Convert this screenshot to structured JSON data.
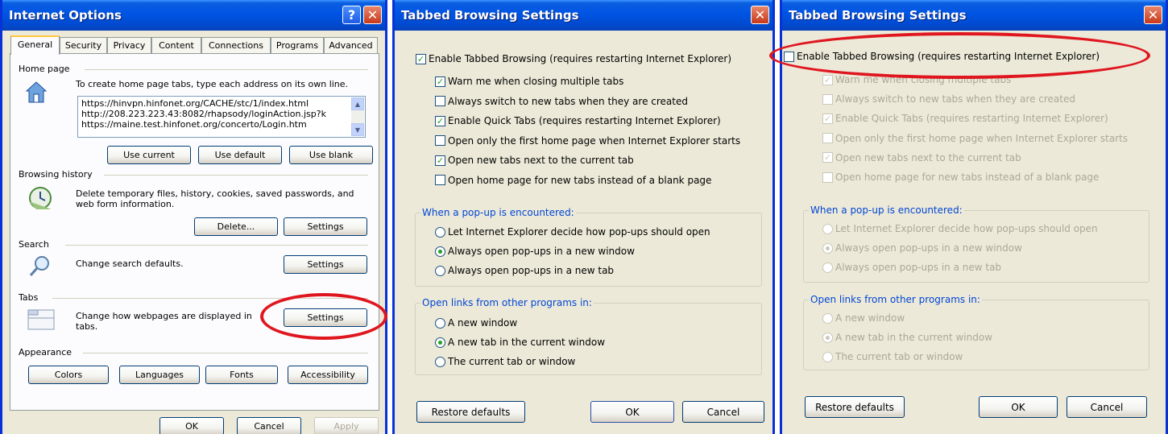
{
  "internet_options": {
    "title": "Internet Options",
    "tabs": [
      "General",
      "Security",
      "Privacy",
      "Content",
      "Connections",
      "Programs",
      "Advanced"
    ],
    "active_tab": "General",
    "home_page": {
      "heading": "Home page",
      "description": "To create home page tabs, type each address on its own line.",
      "urls": [
        "https://hinvpn.hinfonet.org/CACHE/stc/1/index.html",
        "http://208.223.223.43:8082/rhapsody/loginAction.jsp?k",
        "https://maine.test.hinfonet.org/concerto/Login.htm"
      ],
      "buttons": [
        "Use current",
        "Use default",
        "Use blank"
      ]
    },
    "browsing_history": {
      "heading": "Browsing history",
      "description": "Delete temporary files, history, cookies, saved passwords, and web form information.",
      "delete_label": "Delete...",
      "settings_label": "Settings"
    },
    "search": {
      "heading": "Search",
      "description": "Change search defaults.",
      "settings_label": "Settings"
    },
    "tabs_section": {
      "heading": "Tabs",
      "description": "Change how webpages are displayed in tabs.",
      "settings_label": "Settings"
    },
    "appearance": {
      "heading": "Appearance",
      "buttons": [
        "Colors",
        "Languages",
        "Fonts",
        "Accessibility"
      ]
    },
    "footer": {
      "ok": "OK",
      "cancel": "Cancel",
      "apply": "Apply"
    }
  },
  "tabbed_settings_enabled": {
    "title": "Tabbed Browsing Settings",
    "enable_label": "Enable Tabbed Browsing (requires restarting Internet Explorer)",
    "enable_checked": true,
    "options": [
      {
        "label": "Warn me when closing multiple tabs",
        "checked": true
      },
      {
        "label": "Always switch to new tabs when they are created",
        "checked": false
      },
      {
        "label": "Enable Quick Tabs (requires restarting Internet Explorer)",
        "checked": true
      },
      {
        "label": "Open only the first home page when Internet Explorer starts",
        "checked": false
      },
      {
        "label": "Open new tabs next to the current tab",
        "checked": true
      },
      {
        "label": "Open home page for new tabs instead of a blank page",
        "checked": false
      }
    ],
    "popup_group": {
      "title": "When a pop-up is encountered:",
      "options": [
        {
          "label": "Let Internet Explorer decide how pop-ups should open",
          "selected": false
        },
        {
          "label": "Always open pop-ups in a new window",
          "selected": true
        },
        {
          "label": "Always open pop-ups in a new tab",
          "selected": false
        }
      ]
    },
    "links_group": {
      "title": "Open links from other programs in:",
      "options": [
        {
          "label": "A new window",
          "selected": false
        },
        {
          "label": "A new tab in the current window",
          "selected": true
        },
        {
          "label": "The current tab or window",
          "selected": false
        }
      ]
    },
    "footer": {
      "restore": "Restore defaults",
      "ok": "OK",
      "cancel": "Cancel"
    }
  },
  "tabbed_settings_disabled": {
    "title": "Tabbed Browsing Settings",
    "enable_label": "Enable Tabbed Browsing (requires restarting Internet Explorer)",
    "enable_checked": false,
    "options": [
      {
        "label": "Warn me when closing multiple tabs",
        "checked": true
      },
      {
        "label": "Always switch to new tabs when they are created",
        "checked": false
      },
      {
        "label": "Enable Quick Tabs (requires restarting Internet Explorer)",
        "checked": true
      },
      {
        "label": "Open only the first home page when Internet Explorer starts",
        "checked": false
      },
      {
        "label": "Open new tabs next to the current tab",
        "checked": true
      },
      {
        "label": "Open home page for new tabs instead of a blank page",
        "checked": false
      }
    ],
    "popup_group": {
      "title": "When a pop-up is encountered:",
      "options": [
        {
          "label": "Let Internet Explorer decide how pop-ups should open",
          "selected": false
        },
        {
          "label": "Always open pop-ups in a new window",
          "selected": true
        },
        {
          "label": "Always open pop-ups in a new tab",
          "selected": false
        }
      ]
    },
    "links_group": {
      "title": "Open links from other programs in:",
      "options": [
        {
          "label": "A new window",
          "selected": false
        },
        {
          "label": "A new tab in the current window",
          "selected": true
        },
        {
          "label": "The current tab or window",
          "selected": false
        }
      ]
    },
    "footer": {
      "restore": "Restore defaults",
      "ok": "OK",
      "cancel": "Cancel"
    }
  },
  "colors": {
    "titlebar": "#0054e3",
    "dialog_bg": "#ECE9D8",
    "highlight_oval": "#e0161f",
    "group_title": "#0046d5",
    "disabled_text": "#aca899"
  },
  "icons": {
    "help": "?",
    "close": "✕"
  }
}
